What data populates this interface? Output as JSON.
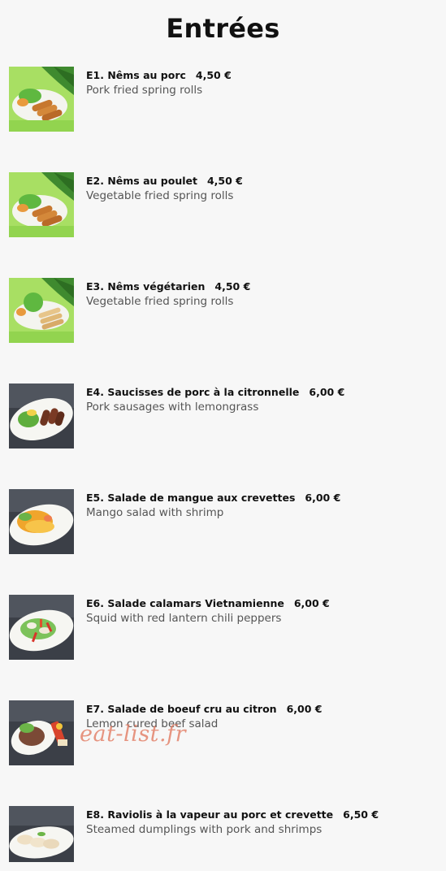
{
  "page": {
    "title": "Entrées"
  },
  "items": [
    {
      "code_name": "E1. Nêms au porc",
      "price": "4,50 €",
      "desc": "Pork fried spring rolls",
      "thumb": "green"
    },
    {
      "code_name": "E2. Nêms au poulet",
      "price": "4,50 €",
      "desc": "Vegetable fried spring rolls",
      "thumb": "green"
    },
    {
      "code_name": "E3. Nêms végétarien",
      "price": "4,50 €",
      "desc": "Vegetable fried spring rolls",
      "thumb": "green"
    },
    {
      "code_name": "E4. Saucisses de porc à la citronnelle",
      "price": "6,00 €",
      "desc": "Pork sausages with lemongrass",
      "thumb": "dark"
    },
    {
      "code_name": "E5. Salade de mangue aux crevettes",
      "price": "6,00 €",
      "desc": "Mango salad with shrimp",
      "thumb": "dark"
    },
    {
      "code_name": "E6. Salade calamars Vietnamienne",
      "price": "6,00 €",
      "desc": "Squid with red lantern chili peppers",
      "thumb": "dark"
    },
    {
      "code_name": "E7. Salade de boeuf cru au citron",
      "price": "6,00 €",
      "desc": "Lemon cured beef salad",
      "thumb": "dark"
    },
    {
      "code_name": "E8. Raviolis à la vapeur au porc et crevette",
      "price": "6,50 €",
      "desc": "Steamed dumplings with pork and shrimps",
      "thumb": "dark"
    }
  ],
  "watermark": "eat-list.fr",
  "colors": {
    "background": "#f7f7f7",
    "text": "#111111",
    "description": "#555555",
    "watermark": "#e2785f"
  }
}
